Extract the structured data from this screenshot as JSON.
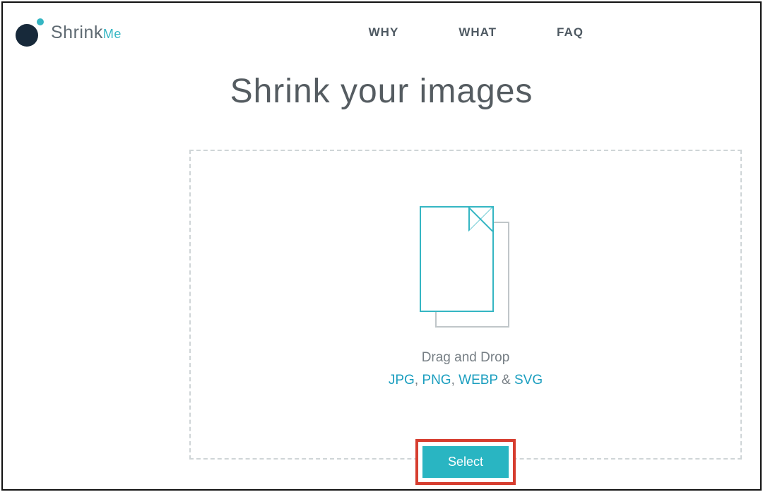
{
  "brand": {
    "primary": "Shrink",
    "accent": "Me"
  },
  "nav": {
    "items": [
      "WHY",
      "WHAT",
      "FAQ"
    ]
  },
  "hero": {
    "title": "Shrink your images"
  },
  "dropzone": {
    "instruction": "Drag and Drop",
    "formats": [
      "JPG",
      "PNG",
      "WEBP",
      "SVG"
    ],
    "separator": ", ",
    "final_separator": " & ",
    "select_label": "Select"
  },
  "colors": {
    "accent": "#29b5c2",
    "highlight_border": "#d63d2f"
  }
}
